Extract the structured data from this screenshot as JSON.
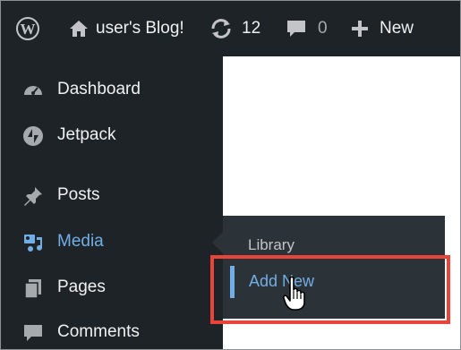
{
  "adminbar": {
    "site_name": "user's Blog!",
    "updates_count": "12",
    "comments_count": "0",
    "new_label": "New"
  },
  "menu": {
    "items": [
      {
        "label": "Dashboard",
        "icon": "dashboard-icon"
      },
      {
        "label": "Jetpack",
        "icon": "jetpack-icon"
      },
      {
        "label": "Posts",
        "icon": "pin-icon"
      },
      {
        "label": "Media",
        "icon": "media-icon"
      },
      {
        "label": "Pages",
        "icon": "pages-icon"
      },
      {
        "label": "Comments",
        "icon": "comments-icon"
      }
    ]
  },
  "submenu": {
    "library_label": "Library",
    "add_new_label": "Add New"
  },
  "colors": {
    "adminbar_bg": "#1d2327",
    "menu_bg": "#1d2327",
    "submenu_bg": "#2c3338",
    "accent": "#72aee6",
    "highlight": "#e8443a"
  }
}
